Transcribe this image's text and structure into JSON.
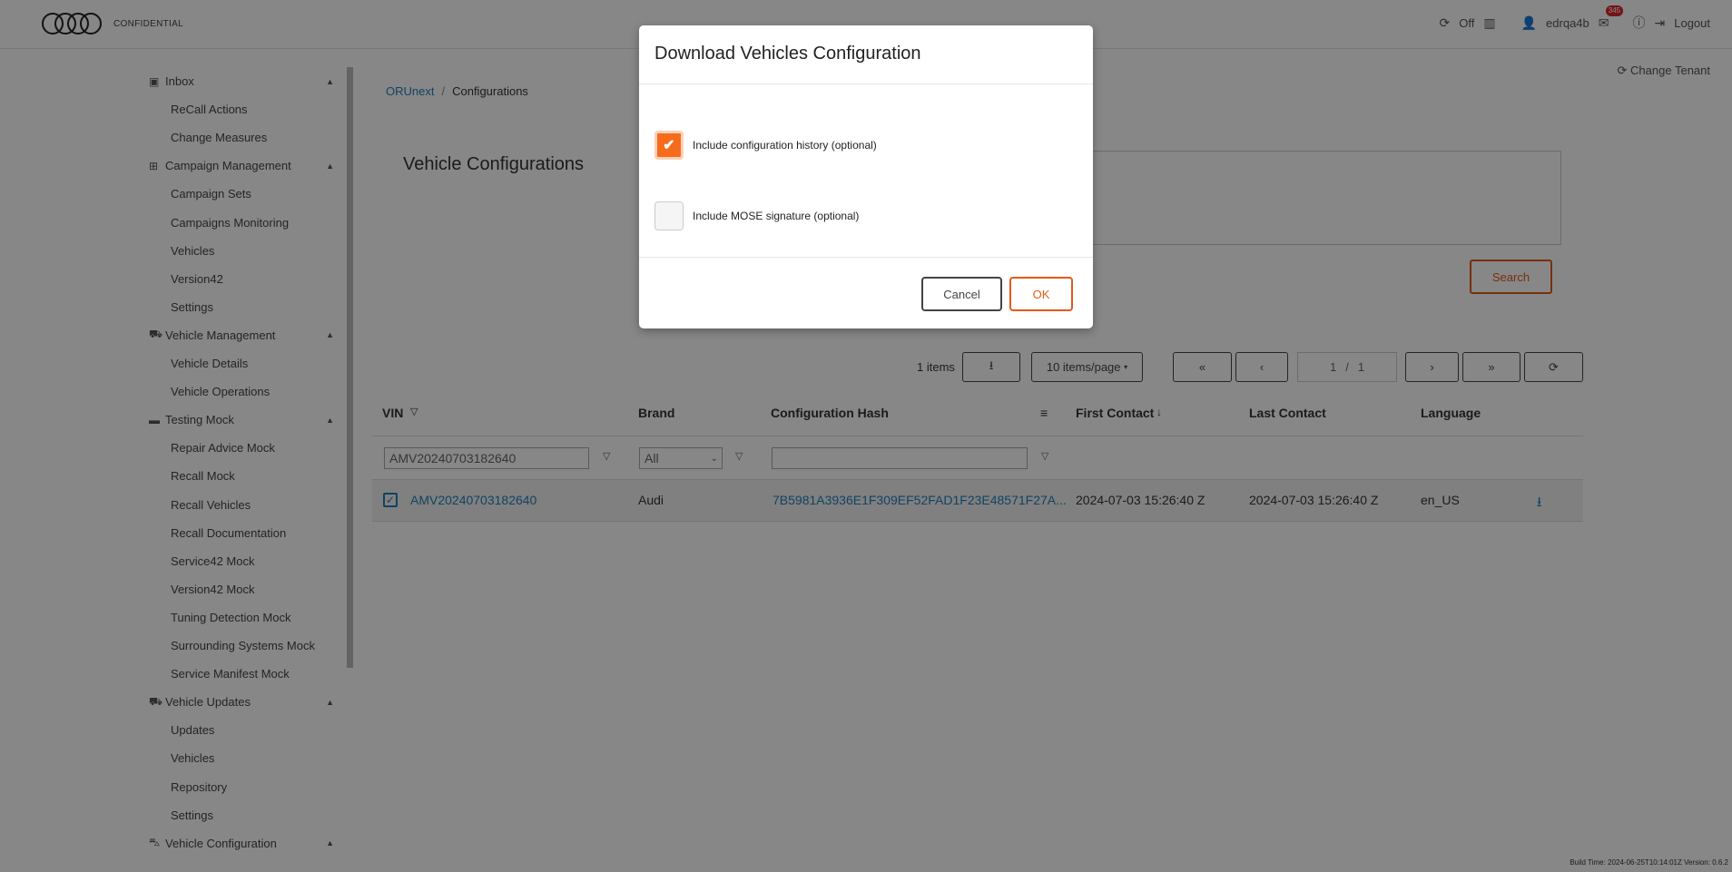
{
  "header": {
    "brand_text": "CONFIDENTIAL",
    "sync_status": "Off",
    "username": "edrqa4b",
    "notification_count": "345",
    "logout_label": "Logout"
  },
  "sidebar": {
    "items": [
      {
        "label": "Inbox",
        "type": "group",
        "icon": "inbox-icon"
      },
      {
        "label": "ReCall Actions",
        "type": "sub"
      },
      {
        "label": "Change Measures",
        "type": "sub"
      },
      {
        "label": "Campaign Management",
        "type": "group",
        "icon": "sitemap-icon"
      },
      {
        "label": "Campaign Sets",
        "type": "sub"
      },
      {
        "label": "Campaigns Monitoring",
        "type": "sub"
      },
      {
        "label": "Vehicles",
        "type": "sub"
      },
      {
        "label": "Version42",
        "type": "sub"
      },
      {
        "label": "Settings",
        "type": "sub"
      },
      {
        "label": "Vehicle Management",
        "type": "group",
        "icon": "cart-icon"
      },
      {
        "label": "Vehicle Details",
        "type": "sub"
      },
      {
        "label": "Vehicle Operations",
        "type": "sub"
      },
      {
        "label": "Testing Mock",
        "type": "group",
        "icon": "folder-icon"
      },
      {
        "label": "Repair Advice Mock",
        "type": "sub"
      },
      {
        "label": "Recall Mock",
        "type": "sub"
      },
      {
        "label": "Recall Vehicles",
        "type": "sub"
      },
      {
        "label": "Recall Documentation",
        "type": "sub"
      },
      {
        "label": "Service42 Mock",
        "type": "sub"
      },
      {
        "label": "Version42 Mock",
        "type": "sub"
      },
      {
        "label": "Tuning Detection Mock",
        "type": "sub"
      },
      {
        "label": "Surrounding Systems Mock",
        "type": "sub"
      },
      {
        "label": "Service Manifest Mock",
        "type": "sub"
      },
      {
        "label": "Vehicle Updates",
        "type": "group",
        "icon": "cart-icon"
      },
      {
        "label": "Updates",
        "type": "sub"
      },
      {
        "label": "Vehicles",
        "type": "sub"
      },
      {
        "label": "Repository",
        "type": "sub"
      },
      {
        "label": "Settings",
        "type": "sub"
      },
      {
        "label": "Vehicle Configuration",
        "type": "group",
        "icon": "car-icon"
      }
    ]
  },
  "breadcrumb": {
    "root": "ORUnext",
    "separator": "/",
    "current": "Configurations"
  },
  "change_tenant_label": "Change Tenant",
  "panel": {
    "title": "Vehicle Configurations",
    "search_label": "Search"
  },
  "toolbar": {
    "items_count": "1 items",
    "page_size": "10 items/page",
    "page_current": "1",
    "page_separator": "/",
    "page_total": "1"
  },
  "table": {
    "headers": {
      "vin": "VIN",
      "brand": "Brand",
      "config_hash": "Configuration Hash",
      "first_contact": "First Contact",
      "last_contact": "Last Contact",
      "language": "Language"
    },
    "filters": {
      "vin_value": "AMV20240703182640",
      "brand_value": "All",
      "hash_value": ""
    },
    "rows": [
      {
        "vin": "AMV20240703182640",
        "brand": "Audi",
        "config_hash": "7B5981A3936E1F309EF52FAD1F23E48571F27A...",
        "first_contact": "2024-07-03 15:26:40 Z",
        "last_contact": "2024-07-03 15:26:40 Z",
        "language": "en_US"
      }
    ]
  },
  "build_info": "Build Time: 2024-06-25T10:14:01Z Version: 0.6.2",
  "modal": {
    "title": "Download Vehicles Configuration",
    "option_history_label": "Include configuration history (optional)",
    "option_history_checked": true,
    "option_mose_label": "Include MOSE signature (optional)",
    "option_mose_checked": false,
    "cancel_label": "Cancel",
    "ok_label": "OK"
  },
  "colors": {
    "accent": "#e15a1a",
    "checkbox_checked": "#f76b1c",
    "link": "#1f7fb8",
    "overlay": "rgba(0,0,0,0.47)"
  }
}
